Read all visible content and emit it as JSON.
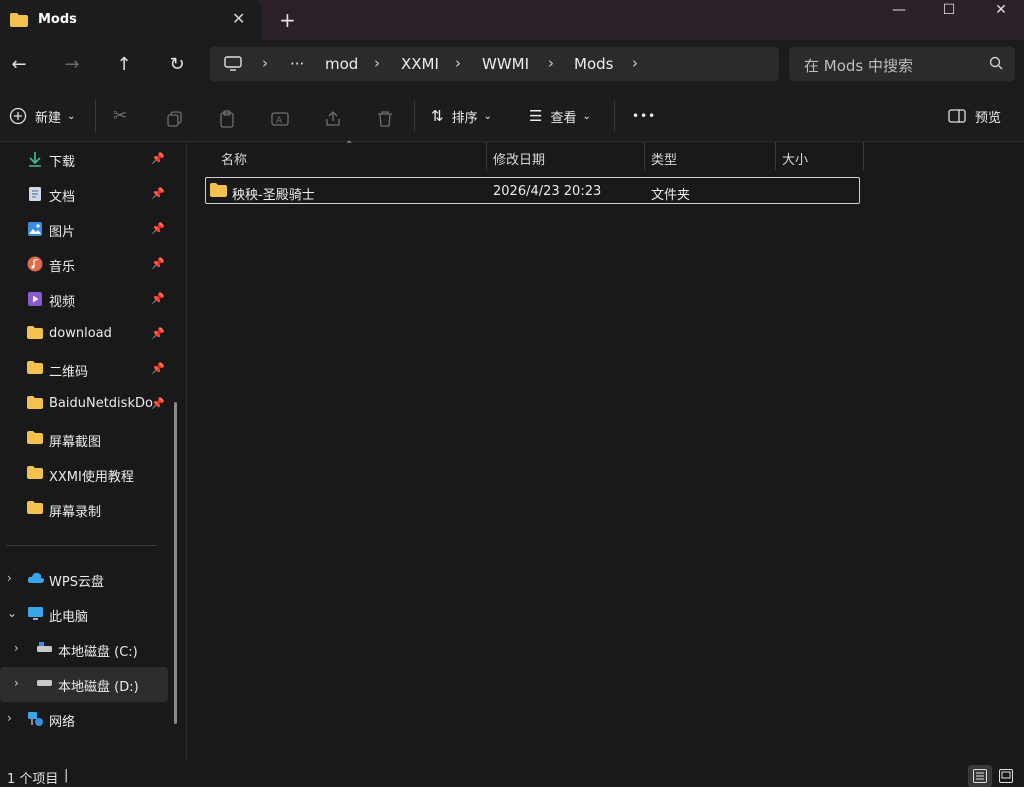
{
  "window": {
    "tab_title": "Mods",
    "tab_close": "✕",
    "new_tab": "+",
    "minimize": "—",
    "maximize": "☐",
    "close": "✕"
  },
  "nav": {
    "breadcrumbs": [
      "mod",
      "XXMI",
      "WWMI",
      "Mods"
    ],
    "overflow": "···",
    "search_placeholder": "在 Mods 中搜索"
  },
  "toolbar": {
    "new_label": "新建",
    "sort_label": "排序",
    "view_label": "查看",
    "more_label": "•••",
    "preview_label": "预览"
  },
  "sidebar": {
    "quick_access": [
      {
        "label": "下载",
        "icon": "download-icon",
        "pinned": true
      },
      {
        "label": "文档",
        "icon": "document-icon",
        "pinned": true
      },
      {
        "label": "图片",
        "icon": "pictures-icon",
        "pinned": true
      },
      {
        "label": "音乐",
        "icon": "music-icon",
        "pinned": true
      },
      {
        "label": "视频",
        "icon": "video-icon",
        "pinned": true
      },
      {
        "label": "download",
        "icon": "folder-icon",
        "pinned": true
      },
      {
        "label": "二维码",
        "icon": "folder-icon",
        "pinned": true
      },
      {
        "label": "BaiduNetdiskDownload",
        "icon": "folder-icon",
        "pinned": true
      },
      {
        "label": "屏幕截图",
        "icon": "folder-icon",
        "pinned": false
      },
      {
        "label": "XXMI使用教程",
        "icon": "folder-icon",
        "pinned": false
      },
      {
        "label": "屏幕录制",
        "icon": "folder-icon",
        "pinned": false
      }
    ],
    "tree": [
      {
        "label": "WPS云盘",
        "icon": "cloud-icon",
        "expanded": false
      },
      {
        "label": "此电脑",
        "icon": "computer-icon",
        "expanded": true
      },
      {
        "label": "本地磁盘 (C:)",
        "icon": "drive-icon",
        "expanded": false
      },
      {
        "label": "本地磁盘 (D:)",
        "icon": "drive-icon",
        "expanded": false,
        "selected": true
      },
      {
        "label": "网络",
        "icon": "network-icon",
        "expanded": false
      }
    ]
  },
  "content": {
    "columns": [
      "名称",
      "修改日期",
      "类型",
      "大小"
    ],
    "rows": [
      {
        "name": "秧秧-圣殿骑士",
        "modified": "2026/4/23 20:23",
        "type": "文件夹",
        "size": ""
      }
    ]
  },
  "status": {
    "item_count": "1 个项目",
    "separator": "|"
  },
  "colors": {
    "titlebar": "#2b1f28",
    "background": "#191919",
    "folder": "#f2c14e",
    "accent": "#4aa0e6"
  }
}
